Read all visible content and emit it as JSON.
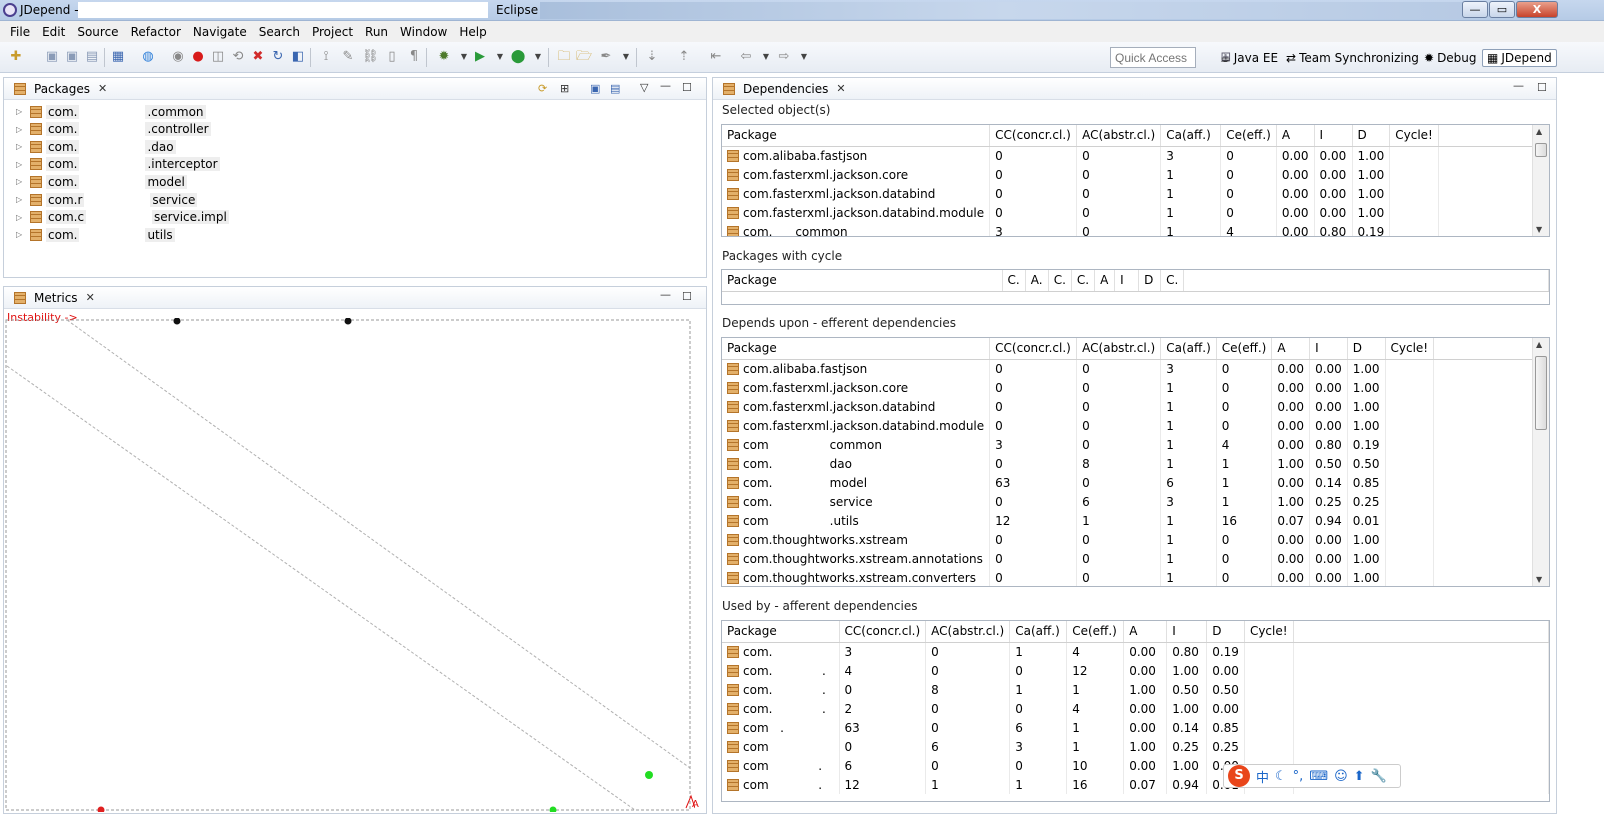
{
  "window": {
    "title": "JDepend -",
    "title_suffix": "Eclipse",
    "minimize": "—",
    "restore": "▭",
    "close": "X"
  },
  "menu": [
    "File",
    "Edit",
    "Source",
    "Refactor",
    "Navigate",
    "Search",
    "Project",
    "Run",
    "Window",
    "Help"
  ],
  "toolbar": {
    "quick_access_placeholder": "Quick Access",
    "perspectives": [
      {
        "label": "Java EE",
        "icon": "java-ee-icon"
      },
      {
        "label": "Team Synchronizing",
        "icon": "team-sync-icon"
      },
      {
        "label": "Debug",
        "icon": "debug-icon"
      },
      {
        "label": "JDepend",
        "icon": "jdepend-icon",
        "active": true
      }
    ]
  },
  "packages_view": {
    "tab_label": "Packages",
    "items": [
      {
        "prefix": "com.",
        "suffix": ".common"
      },
      {
        "prefix": "com.",
        "suffix": ".controller"
      },
      {
        "prefix": "com.",
        "suffix": ".dao"
      },
      {
        "prefix": "com.",
        "suffix": ".interceptor"
      },
      {
        "prefix": "com.",
        "suffix": "model"
      },
      {
        "prefix": "com.r",
        "suffix": "service"
      },
      {
        "prefix": "com.c",
        "suffix": "service.impl"
      },
      {
        "prefix": "com.",
        "suffix": "utils"
      }
    ]
  },
  "metrics_view": {
    "tab_label": "Metrics",
    "instability_label": "Instability ->",
    "corner_label": "A"
  },
  "dependencies_view": {
    "tab_label": "Dependencies",
    "selected": {
      "title": "Selected object(s)",
      "columns": [
        "Package",
        "CC(concr.cl.)",
        "AC(abstr.cl.)",
        "Ca(aff.)",
        "Ce(eff.)",
        "A",
        "I",
        "D",
        "Cycle!"
      ],
      "rows": [
        [
          "com.alibaba.fastjson",
          "0",
          "0",
          "3",
          "0",
          "0.00",
          "0.00",
          "1.00",
          ""
        ],
        [
          "com.fasterxml.jackson.core",
          "0",
          "0",
          "1",
          "0",
          "0.00",
          "0.00",
          "1.00",
          ""
        ],
        [
          "com.fasterxml.jackson.databind",
          "0",
          "0",
          "1",
          "0",
          "0.00",
          "0.00",
          "1.00",
          ""
        ],
        [
          "com.fasterxml.jackson.databind.module",
          "0",
          "0",
          "1",
          "0",
          "0.00",
          "0.00",
          "1.00",
          ""
        ],
        [
          "com.      common",
          "3",
          "0",
          "1",
          "4",
          "0.00",
          "0.80",
          "0.19",
          ""
        ]
      ]
    },
    "cycle": {
      "title": "Packages with cycle",
      "columns": [
        "Package",
        "C.",
        "A.",
        "C.",
        "C.",
        "A",
        "I",
        "D",
        "C."
      ]
    },
    "efferent": {
      "title": "Depends upon - efferent dependencies",
      "columns": [
        "Package",
        "CC(concr.cl.)",
        "AC(abstr.cl.)",
        "Ca(aff.)",
        "Ce(eff.)",
        "A",
        "I",
        "D",
        "Cycle!"
      ],
      "rows": [
        [
          "com.alibaba.fastjson",
          "0",
          "0",
          "3",
          "0",
          "0.00",
          "0.00",
          "1.00",
          ""
        ],
        [
          "com.fasterxml.jackson.core",
          "0",
          "0",
          "1",
          "0",
          "0.00",
          "0.00",
          "1.00",
          ""
        ],
        [
          "com.fasterxml.jackson.databind",
          "0",
          "0",
          "1",
          "0",
          "0.00",
          "0.00",
          "1.00",
          ""
        ],
        [
          "com.fasterxml.jackson.databind.module",
          "0",
          "0",
          "1",
          "0",
          "0.00",
          "0.00",
          "1.00",
          ""
        ],
        [
          "com                common",
          "3",
          "0",
          "1",
          "4",
          "0.00",
          "0.80",
          "0.19",
          ""
        ],
        [
          "com.               dao",
          "0",
          "8",
          "1",
          "1",
          "1.00",
          "0.50",
          "0.50",
          ""
        ],
        [
          "com.               model",
          "63",
          "0",
          "6",
          "1",
          "0.00",
          "0.14",
          "0.85",
          ""
        ],
        [
          "com.               service",
          "0",
          "6",
          "3",
          "1",
          "1.00",
          "0.25",
          "0.25",
          ""
        ],
        [
          "com                .utils",
          "12",
          "1",
          "1",
          "16",
          "0.07",
          "0.94",
          "0.01",
          ""
        ],
        [
          "com.thoughtworks.xstream",
          "0",
          "0",
          "1",
          "0",
          "0.00",
          "0.00",
          "1.00",
          ""
        ],
        [
          "com.thoughtworks.xstream.annotations",
          "0",
          "0",
          "1",
          "0",
          "0.00",
          "0.00",
          "1.00",
          ""
        ],
        [
          "com.thoughtworks.xstream.converters",
          "0",
          "0",
          "1",
          "0",
          "0.00",
          "0.00",
          "1.00",
          ""
        ]
      ]
    },
    "afferent": {
      "title": "Used by - afferent dependencies",
      "columns": [
        "Package",
        "CC(concr.cl.)",
        "AC(abstr.cl.)",
        "Ca(aff.)",
        "Ce(eff.)",
        "A",
        "I",
        "D",
        "Cycle!"
      ],
      "rows": [
        [
          "com.",
          "3",
          "0",
          "1",
          "4",
          "0.00",
          "0.80",
          "0.19",
          ""
        ],
        [
          "com.             .",
          "4",
          "0",
          "0",
          "12",
          "0.00",
          "1.00",
          "0.00",
          ""
        ],
        [
          "com.             .",
          "0",
          "8",
          "1",
          "1",
          "1.00",
          "0.50",
          "0.50",
          ""
        ],
        [
          "com.             .",
          "2",
          "0",
          "0",
          "4",
          "0.00",
          "1.00",
          "0.00",
          ""
        ],
        [
          "com   .",
          "63",
          "0",
          "6",
          "1",
          "0.00",
          "0.14",
          "0.85",
          ""
        ],
        [
          "com",
          "0",
          "6",
          "3",
          "1",
          "1.00",
          "0.25",
          "0.25",
          ""
        ],
        [
          "com             .",
          "6",
          "0",
          "0",
          "10",
          "0.00",
          "1.00",
          "0.00",
          ""
        ],
        [
          "com             .",
          "12",
          "1",
          "1",
          "16",
          "0.07",
          "0.94",
          "0.01",
          ""
        ]
      ]
    }
  },
  "ime": {
    "logo": "S",
    "mode": "中"
  }
}
